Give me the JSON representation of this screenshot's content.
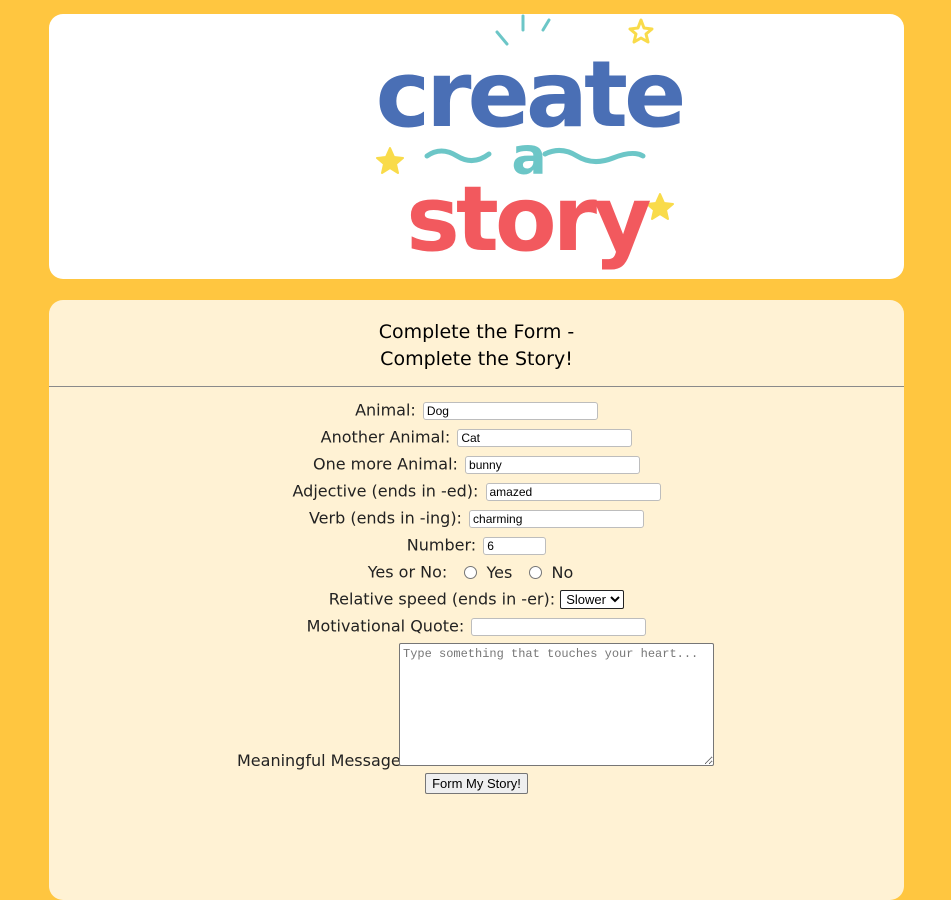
{
  "logo": {
    "line1": "create",
    "line2": "a",
    "line3": "story",
    "colors": {
      "create": "#4A6FB5",
      "a": "#6CC6C7",
      "story": "#F2595E",
      "star": "#F9DB4A"
    }
  },
  "form": {
    "title_line1": "Complete the Form -",
    "title_line2": "Complete the Story!",
    "animal": {
      "label": "Animal:",
      "value": "Dog"
    },
    "another_animal": {
      "label": "Another Animal:",
      "value": "Cat"
    },
    "one_more_animal": {
      "label": "One more Animal:",
      "value": "bunny"
    },
    "adjective": {
      "label": "Adjective (ends in -ed):",
      "value": "amazed"
    },
    "verb": {
      "label": "Verb (ends in -ing):",
      "value": "charming"
    },
    "number": {
      "label": "Number:",
      "value": "6"
    },
    "yes_no": {
      "label": "Yes or No:",
      "yes": "Yes",
      "no": "No"
    },
    "speed": {
      "label": "Relative speed (ends in -er):",
      "selected": "Slower"
    },
    "quote": {
      "label": "Motivational Quote:",
      "value": ""
    },
    "message": {
      "label": "Meaningful Message:",
      "placeholder": "Type something that touches your heart..."
    },
    "submit_label": "Form My Story!"
  },
  "colors": {
    "page_bg": "#FFC640",
    "header_bg": "#FFFFFF",
    "form_bg": "#FFF2D4"
  }
}
